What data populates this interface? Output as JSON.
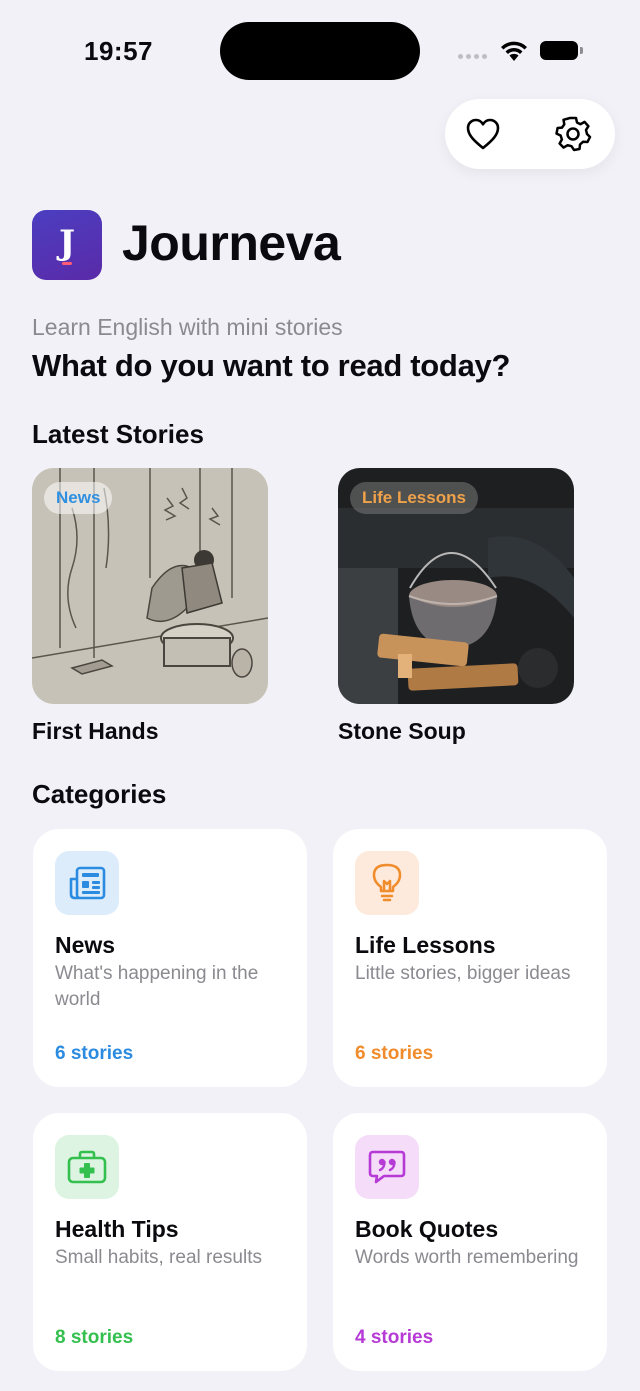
{
  "status_bar": {
    "time": "19:57"
  },
  "header": {
    "logo_letter": "J",
    "app_title": "Journeva",
    "subtitle": "Learn English with mini stories",
    "headline": "What do you want to read today?"
  },
  "toolbar": {
    "favorites_icon": "heart-icon",
    "settings_icon": "gear-icon"
  },
  "latest": {
    "title": "Latest Stories",
    "stories": [
      {
        "badge": "News",
        "title": "First Hands",
        "badge_color": "#2f8fe0"
      },
      {
        "badge": "Life Lessons",
        "title": "Stone Soup",
        "badge_color": "#f0a24a"
      }
    ]
  },
  "categories": {
    "title": "Categories",
    "items": [
      {
        "name": "News",
        "desc": "What's happening in the world",
        "count": "6 stories",
        "color": "#2b8be0",
        "icon": "newspaper-icon"
      },
      {
        "name": "Life Lessons",
        "desc": "Little stories, bigger ideas",
        "count": "6 stories",
        "color": "#f08c2c",
        "icon": "lightbulb-icon"
      },
      {
        "name": "Health Tips",
        "desc": "Small habits, real results",
        "count": "8 stories",
        "color": "#33c04f",
        "icon": "first-aid-kit-icon"
      },
      {
        "name": "Book Quotes",
        "desc": "Words worth remembering",
        "count": "4 stories",
        "color": "#b63ad6",
        "icon": "quote-bubble-icon"
      }
    ]
  }
}
